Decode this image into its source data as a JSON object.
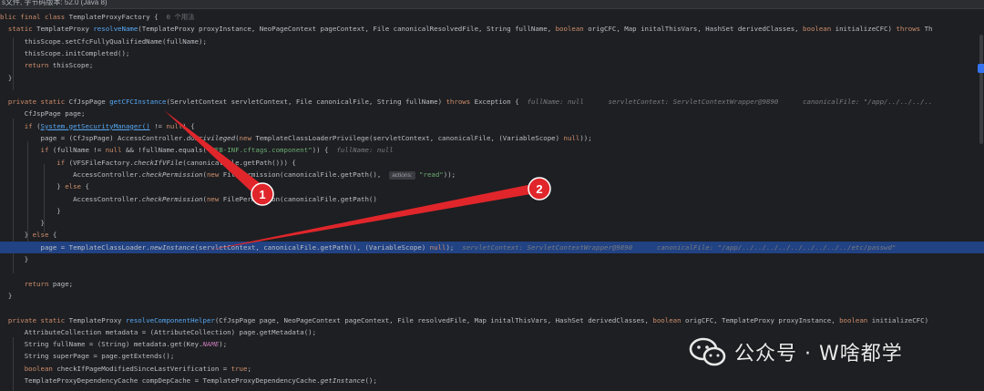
{
  "window": {
    "title_bar": "s文件, 字节码版本: 52.0 (Java 8)"
  },
  "code_lines": [
    {
      "segs": [
        {
          "t": "blic final class ",
          "c": "kw"
        },
        {
          "t": "TemplateProxyFactory {  "
        },
        {
          "t": "0 个用法",
          "c": "gut"
        }
      ]
    },
    {
      "segs": [
        {
          "t": "  static ",
          "c": "kw"
        },
        {
          "t": "TemplateProxy "
        },
        {
          "t": "resolveName",
          "c": "fn"
        },
        {
          "t": "(TemplateProxy proxyInstance, NeoPageContext pageContext, File canonicalResolvedFile, String fullName, "
        },
        {
          "t": "boolean ",
          "c": "kw"
        },
        {
          "t": "origCFC, Map initalThisVars, HashSet derivedClasses, "
        },
        {
          "t": "boolean ",
          "c": "kw"
        },
        {
          "t": "initializeCFC) "
        },
        {
          "t": "throws ",
          "c": "kw"
        },
        {
          "t": "Th"
        }
      ]
    },
    {
      "segs": [
        {
          "t": "      thisScope.setCfcFullyQualifiedName(fullName);"
        }
      ]
    },
    {
      "segs": [
        {
          "t": "      thisScope.initCompleted();"
        }
      ]
    },
    {
      "segs": [
        {
          "t": "      "
        },
        {
          "t": "return ",
          "c": "kw"
        },
        {
          "t": "thisScope;"
        }
      ]
    },
    {
      "segs": [
        {
          "t": "  }"
        }
      ]
    },
    {
      "segs": [
        {
          "t": ""
        }
      ]
    },
    {
      "segs": [
        {
          "t": "  "
        },
        {
          "t": "private static ",
          "c": "kw"
        },
        {
          "t": "CfJspPage "
        },
        {
          "t": "getCFCInstance",
          "c": "fn"
        },
        {
          "t": "(ServletContext servletContext, File canonicalFile, String fullName) "
        },
        {
          "t": "throws ",
          "c": "kw"
        },
        {
          "t": "Exception {  "
        },
        {
          "t": "fullName: null      servletContext: ServletContextWrapper@9890      canonicalFile: \"/app/../../../..",
          "c": "ann"
        }
      ]
    },
    {
      "segs": [
        {
          "t": "      CfJspPage page;"
        }
      ]
    },
    {
      "segs": [
        {
          "t": "      "
        },
        {
          "t": "if ",
          "c": "kw"
        },
        {
          "t": "("
        },
        {
          "t": "System.getSecurityManager()",
          "c": "lk"
        },
        {
          "t": " != "
        },
        {
          "t": "null",
          "c": "kw"
        },
        {
          "t": ") {"
        }
      ]
    },
    {
      "segs": [
        {
          "t": "          page = (CfJspPage) AccessController."
        },
        {
          "t": "doPrivileged",
          "c": "it"
        },
        {
          "t": "("
        },
        {
          "t": "new ",
          "c": "kw"
        },
        {
          "t": "TemplateClassLoaderPrivilege(servletContext, canonicalFile, (VariableScope) "
        },
        {
          "t": "null",
          "c": "kw"
        },
        {
          "t": "));"
        }
      ]
    },
    {
      "segs": [
        {
          "t": "          "
        },
        {
          "t": "if ",
          "c": "kw"
        },
        {
          "t": "(fullName != "
        },
        {
          "t": "null ",
          "c": "kw"
        },
        {
          "t": "&& !fullName.equals("
        },
        {
          "t": "\"WEB-INF.cftags.component\"",
          "c": "st"
        },
        {
          "t": ")) {  "
        },
        {
          "t": "fullName: null",
          "c": "ann"
        }
      ]
    },
    {
      "segs": [
        {
          "t": "              "
        },
        {
          "t": "if ",
          "c": "kw"
        },
        {
          "t": "(VFSFileFactory."
        },
        {
          "t": "checkIfVFile",
          "c": "it"
        },
        {
          "t": "(canonicalFile.getPath())) {"
        }
      ]
    },
    {
      "segs": [
        {
          "t": "                  AccessController."
        },
        {
          "t": "checkPermission",
          "c": "it"
        },
        {
          "t": "("
        },
        {
          "t": "new ",
          "c": "kw"
        },
        {
          "t": "FilePermission(canonicalFile.getPath(),  "
        },
        {
          "t": "actions:",
          "c": "hint"
        },
        {
          "t": " "
        },
        {
          "t": "\"read\"",
          "c": "st"
        },
        {
          "t": "));"
        }
      ]
    },
    {
      "segs": [
        {
          "t": "              } "
        },
        {
          "t": "else ",
          "c": "kw"
        },
        {
          "t": "{"
        }
      ]
    },
    {
      "segs": [
        {
          "t": "                  AccessController."
        },
        {
          "t": "checkPermission",
          "c": "it"
        },
        {
          "t": "("
        },
        {
          "t": "new ",
          "c": "kw"
        },
        {
          "t": "FilePermission(canonicalFile.getPath()"
        }
      ]
    },
    {
      "segs": [
        {
          "t": "              }"
        }
      ]
    },
    {
      "segs": [
        {
          "t": "          }"
        }
      ]
    },
    {
      "segs": [
        {
          "t": "      } "
        },
        {
          "t": "else ",
          "c": "kw"
        },
        {
          "t": "{"
        }
      ]
    },
    {
      "hl": true,
      "segs": [
        {
          "t": "          page = TemplateClassLoader."
        },
        {
          "t": "newInstance",
          "c": "it"
        },
        {
          "t": "(servletContext, canonicalFile.getPath(), (VariableScope) "
        },
        {
          "t": "null",
          "c": "kw"
        },
        {
          "t": ");  "
        },
        {
          "t": "servletContext: ServletContextWrapper@9890      canonicalFile: \"/app/../../../../../../../../../etc/passwd\"",
          "c": "ann"
        }
      ]
    },
    {
      "segs": [
        {
          "t": "      }"
        }
      ]
    },
    {
      "segs": [
        {
          "t": ""
        }
      ]
    },
    {
      "segs": [
        {
          "t": "      "
        },
        {
          "t": "return ",
          "c": "kw"
        },
        {
          "t": "page;"
        }
      ]
    },
    {
      "segs": [
        {
          "t": "  }"
        }
      ]
    },
    {
      "segs": [
        {
          "t": ""
        }
      ]
    },
    {
      "segs": [
        {
          "t": "  "
        },
        {
          "t": "private static ",
          "c": "kw"
        },
        {
          "t": "TemplateProxy "
        },
        {
          "t": "resolveComponentHelper",
          "c": "fn"
        },
        {
          "t": "(CfJspPage page, NeoPageContext pageContext, File resolvedFile, Map initalThisVars, HashSet derivedClasses, "
        },
        {
          "t": "boolean ",
          "c": "kw"
        },
        {
          "t": "origCFC, TemplateProxy proxyInstance, "
        },
        {
          "t": "boolean ",
          "c": "kw"
        },
        {
          "t": "initializeCFC)"
        }
      ]
    },
    {
      "segs": [
        {
          "t": "      AttributeCollection metadata = (AttributeCollection) page.getMetadata();"
        }
      ]
    },
    {
      "segs": [
        {
          "t": "      String fullName = (String) metadata.get(Key."
        },
        {
          "t": "NAME",
          "c": "cst"
        },
        {
          "t": ");"
        }
      ]
    },
    {
      "segs": [
        {
          "t": "      String superPage = page.getExtends();"
        }
      ]
    },
    {
      "segs": [
        {
          "t": "      "
        },
        {
          "t": "boolean ",
          "c": "kw"
        },
        {
          "t": "checkIfPageModifiedSinceLastVerification = "
        },
        {
          "t": "true",
          "c": "kw"
        },
        {
          "t": ";"
        }
      ]
    },
    {
      "segs": [
        {
          "t": "      TemplateProxyDependencyCache compDepCache = TemplateProxyDependencyCache."
        },
        {
          "t": "getInstance",
          "c": "it"
        },
        {
          "t": "();"
        }
      ]
    }
  ],
  "markers": [
    {
      "label": "1"
    },
    {
      "label": "2"
    }
  ],
  "watermark": {
    "text": "公众号 · W啥都学",
    "icon": "wechat-icon"
  },
  "colors": {
    "background": "#1e1f22",
    "highlight_line": "#214283",
    "keyword": "#cf8e6d",
    "method": "#56a8f5",
    "string": "#6aab73",
    "annotation_arrow": "#e0262b"
  }
}
